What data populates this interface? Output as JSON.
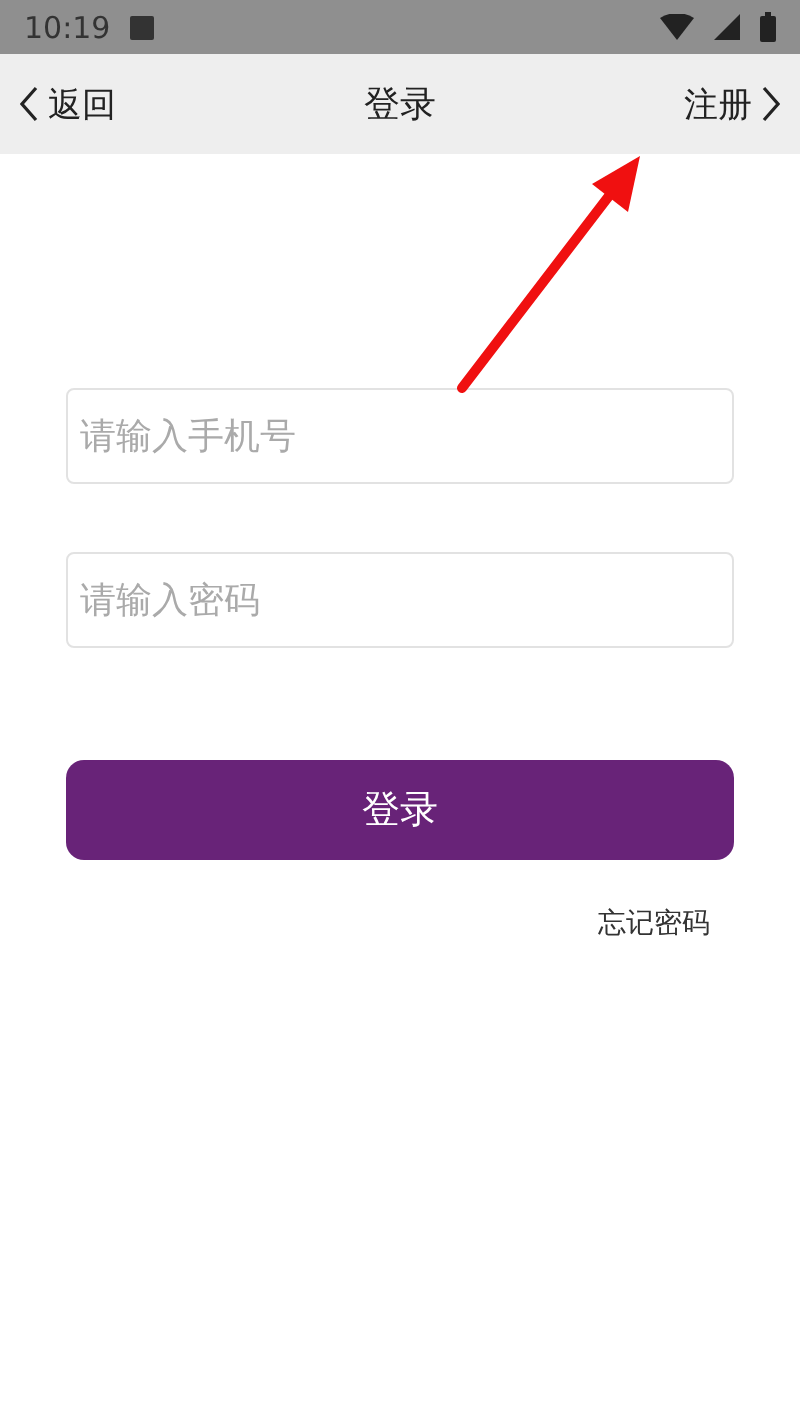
{
  "status_bar": {
    "time": "10:19"
  },
  "nav_bar": {
    "back": "返回",
    "title": "登录",
    "register": "注册"
  },
  "form": {
    "phone": {
      "placeholder": "请输入手机号"
    },
    "password": {
      "placeholder": "请输入密码"
    },
    "submit": "登录",
    "forgot": "忘记密码"
  }
}
